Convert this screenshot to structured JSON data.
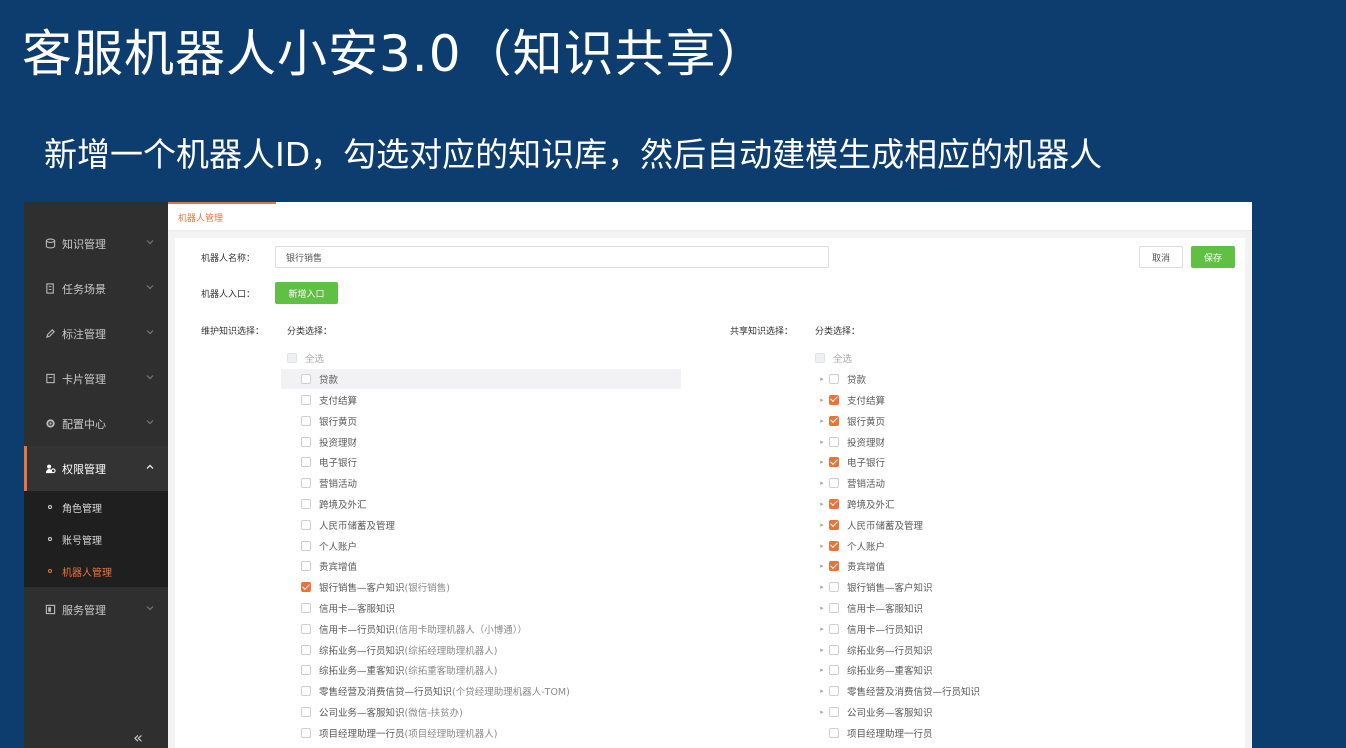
{
  "slide": {
    "title": "客服机器人小安3.0（知识共享）",
    "subtitle": "新增一个机器人ID，勾选对应的知识库，然后自动建模生成相应的机器人"
  },
  "sidebar": {
    "items": [
      {
        "label": "知识管理",
        "icon": "database-icon"
      },
      {
        "label": "任务场景",
        "icon": "document-icon"
      },
      {
        "label": "标注管理",
        "icon": "pen-icon"
      },
      {
        "label": "卡片管理",
        "icon": "card-icon"
      },
      {
        "label": "配置中心",
        "icon": "gear-icon"
      },
      {
        "label": "权限管理",
        "icon": "users-icon"
      }
    ],
    "submenu": [
      "角色管理",
      "账号管理",
      "机器人管理"
    ],
    "after": {
      "label": "服务管理",
      "icon": "service-icon"
    },
    "collapse": "«"
  },
  "breadcrumb": {
    "tab": "机器人管理"
  },
  "form": {
    "name_label": "机器人名称：",
    "name_value": "银行销售",
    "entry_label": "机器人入口：",
    "add_entry": "新增入口",
    "cancel": "取消",
    "save": "保存",
    "maintain_label": "维护知识选择：",
    "share_label": "共享知识选择：",
    "category_label": "分类选择：",
    "select_all": "全选"
  },
  "left_tree": [
    {
      "label": "贷款",
      "checked": false
    },
    {
      "label": "支付结算",
      "checked": false
    },
    {
      "label": "银行黄页",
      "checked": false
    },
    {
      "label": "投资理财",
      "checked": false
    },
    {
      "label": "电子银行",
      "checked": false
    },
    {
      "label": "营销活动",
      "checked": false
    },
    {
      "label": "跨境及外汇",
      "checked": false
    },
    {
      "label": "人民币储蓄及管理",
      "checked": false
    },
    {
      "label": "个人账户",
      "checked": false
    },
    {
      "label": "贵宾增值",
      "checked": false
    },
    {
      "label": "银行销售—客户知识",
      "sub": "(银行销售)",
      "checked": true
    },
    {
      "label": "信用卡—客服知识",
      "sub": "",
      "checked": false
    },
    {
      "label": "信用卡—行员知识",
      "sub": "(信用卡助理机器人（小博通））",
      "checked": false
    },
    {
      "label": "综拓业务—行员知识",
      "sub": "(综拓经理助理机器人)",
      "checked": false
    },
    {
      "label": "综拓业务—重客知识",
      "sub": "(综拓重客助理机器人)",
      "checked": false
    },
    {
      "label": "零售经营及消费信贷—行员知识",
      "sub": "(个贷经理助理机器人-TOM)",
      "checked": false
    },
    {
      "label": "公司业务—客服知识",
      "sub": "(微信-扶贫办)",
      "checked": false
    },
    {
      "label": "项目经理助理一行员",
      "sub": "(项目经理助理机器人)",
      "checked": false
    }
  ],
  "right_tree": [
    {
      "label": "贷款",
      "checked": false
    },
    {
      "label": "支付结算",
      "checked": true
    },
    {
      "label": "银行黄页",
      "checked": true
    },
    {
      "label": "投资理财",
      "checked": false
    },
    {
      "label": "电子银行",
      "checked": true
    },
    {
      "label": "营销活动",
      "checked": false
    },
    {
      "label": "跨境及外汇",
      "checked": true
    },
    {
      "label": "人民币储蓄及管理",
      "checked": true
    },
    {
      "label": "个人账户",
      "checked": true
    },
    {
      "label": "贵宾增值",
      "checked": true
    },
    {
      "label": "银行销售—客户知识",
      "checked": false
    },
    {
      "label": "信用卡—客服知识",
      "checked": false
    },
    {
      "label": "信用卡—行员知识",
      "checked": false
    },
    {
      "label": "综拓业务—行员知识",
      "checked": false
    },
    {
      "label": "综拓业务—重客知识",
      "checked": false
    },
    {
      "label": "零售经营及消费信贷—行员知识",
      "checked": false
    },
    {
      "label": "公司业务—客服知识",
      "checked": false
    },
    {
      "label": "项目经理助理一行员",
      "checked": false
    }
  ],
  "colors": {
    "accent": "#e8743b",
    "green": "#5fc044",
    "slide_bg": "#0d3c6e",
    "sidebar": "#2f2f2f"
  }
}
